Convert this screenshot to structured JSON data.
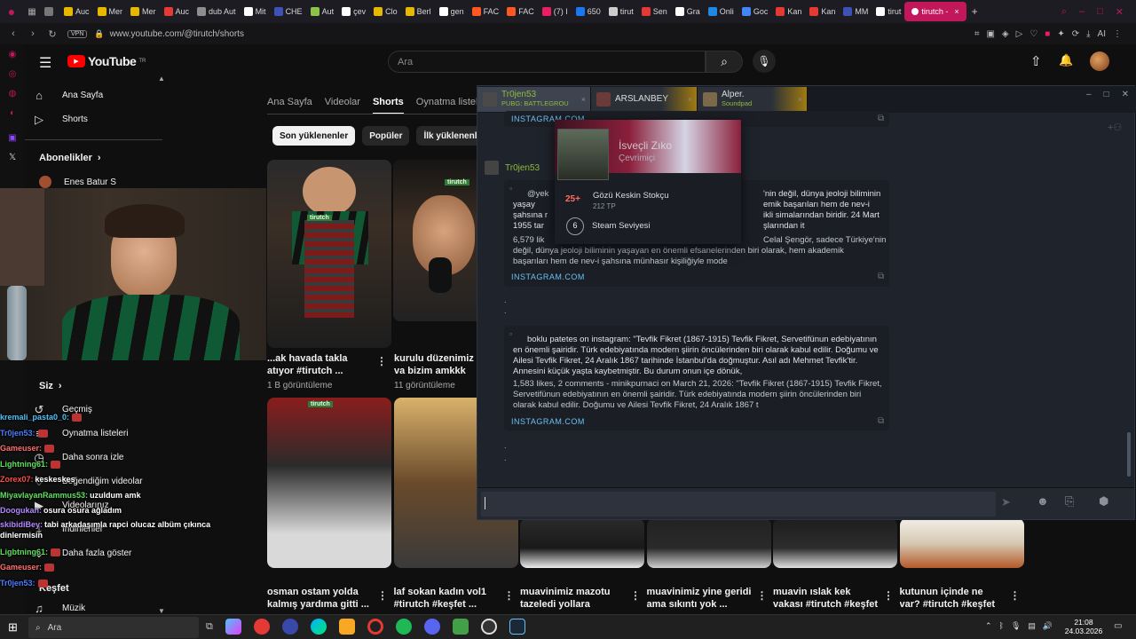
{
  "browser": {
    "tabs": [
      {
        "label": "",
        "color": "#777"
      },
      {
        "label": "Auc",
        "color": "#e6b800"
      },
      {
        "label": "Mer",
        "color": "#e6b800"
      },
      {
        "label": "Mer",
        "color": "#e6b800"
      },
      {
        "label": "Auc",
        "color": "#e53935"
      },
      {
        "label": "dub Aut",
        "color": "#8e8e8e"
      },
      {
        "label": "Mit",
        "color": "#ffffff"
      },
      {
        "label": "CHE",
        "color": "#3f51b5"
      },
      {
        "label": "Aut",
        "color": "#8bc34a"
      },
      {
        "label": "çev",
        "color": "#ffffff"
      },
      {
        "label": "Clo",
        "color": "#e6b800"
      },
      {
        "label": "Berl",
        "color": "#e6b800"
      },
      {
        "label": "gen",
        "color": "#ffffff"
      },
      {
        "label": "FAC",
        "color": "#ff5722"
      },
      {
        "label": "FAC",
        "color": "#ff5722"
      },
      {
        "label": "(7) I",
        "color": "#e91e63"
      },
      {
        "label": "650",
        "color": "#1877f2"
      },
      {
        "label": "tirut",
        "color": "#cccccc"
      },
      {
        "label": "Sen",
        "color": "#e53935"
      },
      {
        "label": "Gra",
        "color": "#ffffff"
      },
      {
        "label": "Onli",
        "color": "#1e88e5"
      },
      {
        "label": "Goc",
        "color": "#4285f4"
      },
      {
        "label": "Kan",
        "color": "#e53935"
      },
      {
        "label": "Kan",
        "color": "#e53935"
      },
      {
        "label": "MM",
        "color": "#3f51b5"
      },
      {
        "label": "tirut",
        "color": "#ffffff"
      }
    ],
    "active_tab": "tirutch -",
    "new_tab": "+",
    "vpn": "VPN",
    "url": "www.youtube.com/@tirutch/shorts",
    "ai_label": "AI"
  },
  "youtube": {
    "logo": "YouTube",
    "logo_sup": "TR",
    "search_placeholder": "Ara",
    "sidebar_top": [
      {
        "label": "Ana Sayfa",
        "icon": "home-icon"
      },
      {
        "label": "Shorts",
        "icon": "shorts-icon"
      }
    ],
    "subs_heading": "Abonelikler",
    "subs": [
      {
        "label": "Enes Batur S"
      }
    ],
    "you_heading": "Siz",
    "you_items": [
      {
        "label": "Geçmiş"
      },
      {
        "label": "Oynatma listeleri"
      },
      {
        "label": "Daha sonra izle"
      },
      {
        "label": "Beğendiğim videolar"
      },
      {
        "label": "Videolarınız"
      },
      {
        "label": "İndirilenler"
      },
      {
        "label": "Daha fazla göster"
      }
    ],
    "explore_heading": "Keşfet",
    "explore_items": [
      {
        "label": "Müzik"
      }
    ],
    "channel_tabs": [
      "Ana Sayfa",
      "Videolar",
      "Shorts",
      "Oynatma listeleri"
    ],
    "active_channel_tab": "Shorts",
    "chips": [
      "Son yüklenenler",
      "Popüler",
      "İlk yüklenenler"
    ],
    "row1": [
      {
        "title": "...ak havada takla atıyor #tirutch ...",
        "views": "1 B görüntüleme"
      },
      {
        "title": "kurulu düzenimiz va bizim amkkk #tiru",
        "views": "11 görüntüleme"
      }
    ],
    "row2": [
      {
        "title": "osman ostam yolda kalmış yardıma gitti ..."
      },
      {
        "title": "laf sokan kadın vol1 #tirutch #keşfet ..."
      },
      {
        "title": "muavinimiz mazotu tazeledi yollara devam..."
      },
      {
        "title": "muavinimiz yine geridi ama sıkıntı yok ..."
      },
      {
        "title": "muavin ıslak kek vakası #tirutch #keşfet ..."
      },
      {
        "title": "kutunun içinde ne var? #tirutch #keşfet ..."
      }
    ],
    "watermark": "tirutch"
  },
  "steam_chat": {
    "tabs": [
      {
        "name": "Tr0jen53",
        "status": "PUBG: BATTLEGROU",
        "status_color": "#90ba3c",
        "name_color": "#90ba3c"
      },
      {
        "name": "ARSLANBEY",
        "status": "",
        "status_color": "#9aa0a8",
        "name_color": "#dcdedf"
      },
      {
        "name": "Alper.",
        "status": "Soundpad",
        "status_color": "#90ba3c",
        "name_color": "#dcdedf"
      }
    ],
    "embed_link": "INSTAGRAM.COM",
    "sender": "Tr0jen53",
    "embed1": {
      "prefix": "@yek",
      "line1": "yaşay",
      "line2": "şahsına r",
      "line3": "1955 tar",
      "right1": "'nin değil, dünya jeoloji biliminin",
      "right2": "emik başarıları hem de nev-i",
      "right3": "ikli simalarından biridir. 24 Mart",
      "right4": "şlarından it",
      "likes": "6,579 lik",
      "right5": "Celal Şengör, sadece Türkiye'nin",
      "body": "değil, dünya jeoloji biliminin yaşayan en önemli efsanelerinden biri olarak, hem akademik başarıları hem de nev-i şahsına münhasır kişiliğiyle mode"
    },
    "embed2": {
      "title": "boklu patetes on instagram: \"Tevfik Fikret (1867-1915) Tevfik Fikret, Servetifünun edebiyatının en önemli şairidir. Türk edebiyatında modern şiirin öncülerinden biri olarak kabul edilir. Doğumu ve Ailesi Tevfik Fikret, 24 Aralık 1867 tarihinde İstanbul'da doğmuştur. Asıl adı Mehmet Tevfik'tir. Annesini küçük yaşta kaybetmiştir. Bu durum onun içe dönük,",
      "body": "1,583 likes, 2 comments - minikpurnaci on March 21, 2026: \"Tevfik Fikret (1867-1915) Tevfik Fikret, Servetifünun edebiyatının en önemli şairidir. Türk edebiyatında modern şiirin öncülerinden biri olarak kabul edilir. Doğumu ve Ailesi Tevfik Fikret, 24 Aralık 1867 t"
    },
    "dots": [
      ".",
      ".",
      ".",
      "."
    ]
  },
  "profile_popup": {
    "title": "İsveçli Zıko",
    "subtitle": "Çevrimiçi",
    "badge_level": "25+",
    "badge_name": "Gözü Keskin Stokçu",
    "badge_xp": "212 TP",
    "steam_level": "6",
    "steam_level_label": "Steam Seviyesi"
  },
  "twitch_chat": [
    {
      "user": "kremali_pasta0_0:",
      "text": "",
      "color": "#4fc3f7"
    },
    {
      "user": "Tr0jen53:",
      "text": "",
      "color": "#4d7cff"
    },
    {
      "user": "Gameuser:",
      "text": "",
      "color": "#ff6e6e"
    },
    {
      "user": "Lightning61:",
      "text": "",
      "color": "#5fe05f"
    },
    {
      "user": "Zorex07:",
      "text": "keskeskes",
      "color": "#ff4d4d"
    },
    {
      "user": "MiyavlayanRammus53:",
      "text": "uzuldum amk",
      "color": "#5fe05f"
    },
    {
      "user": "Doogukan:",
      "text": "osura osura ağladım",
      "color": "#b388ff"
    },
    {
      "user": "skibidiBey:",
      "text": "tabi arkadaşımla rapci olucaz albüm çıkınca dinlermisin",
      "color": "#b388ff"
    },
    {
      "user": "Ligbtning61:",
      "text": "",
      "color": "#5fe05f"
    },
    {
      "user": "Gameuser:",
      "text": "",
      "color": "#ff6e6e"
    },
    {
      "user": "Tr0jen53:",
      "text": "",
      "color": "#4d7cff"
    }
  ],
  "taskbar": {
    "search_placeholder": "Ara",
    "time": "21:08",
    "date": "24.03.2026"
  }
}
